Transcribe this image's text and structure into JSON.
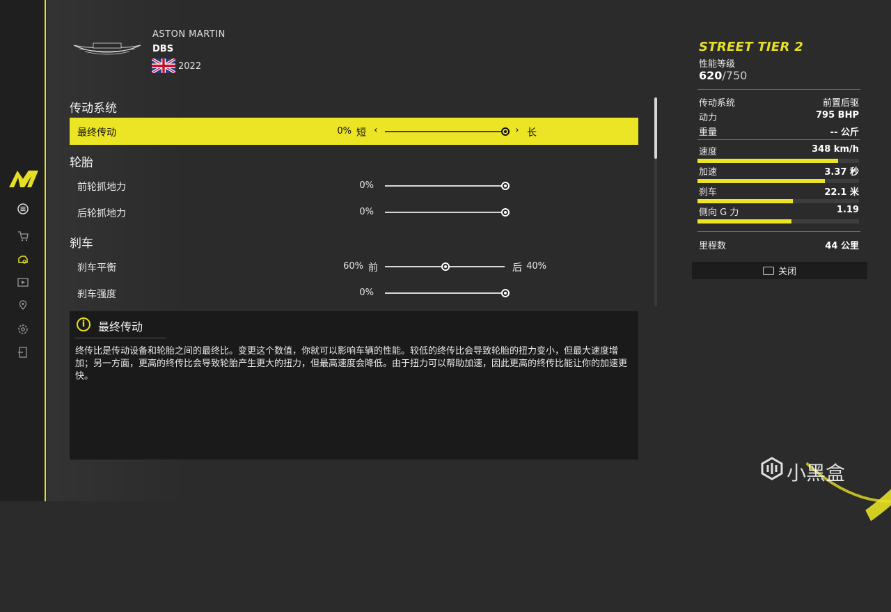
{
  "car": {
    "brand": "ASTON MARTIN",
    "model": "DBS",
    "year": "2022",
    "country_flag": "uk-flag-icon"
  },
  "sidebar": {
    "items": [
      {
        "icon": "menu-icon"
      },
      {
        "icon": "cart-icon"
      },
      {
        "icon": "car-tuning-icon"
      },
      {
        "icon": "video-icon"
      },
      {
        "icon": "map-pin-icon"
      },
      {
        "icon": "settings-icon"
      },
      {
        "icon": "exit-icon"
      }
    ]
  },
  "settings": {
    "sections": [
      {
        "title": "传动系统",
        "rows": [
          {
            "label": "最终传动",
            "value": "0%",
            "left_word": "短",
            "right_word": "长",
            "position": 1.0,
            "active": true
          }
        ]
      },
      {
        "title": "轮胎",
        "rows": [
          {
            "label": "前轮抓地力",
            "value": "0%",
            "position": 1.0
          },
          {
            "label": "后轮抓地力",
            "value": "0%",
            "position": 1.0
          }
        ]
      },
      {
        "title": "刹车",
        "rows": [
          {
            "label": "刹车平衡",
            "value": "60%",
            "left_word": "前",
            "right_word": "后",
            "right_value": "40%",
            "position": 0.5
          },
          {
            "label": "刹车强度",
            "value": "0%",
            "position": 1.0
          }
        ]
      }
    ]
  },
  "info": {
    "title": "最终传动",
    "text": "终传比是传动设备和轮胎之间的最终比。变更这个数值，你就可以影响车辆的性能。较低的终传比会导致轮胎的扭力变小，但最大速度增加；另一方面，更高的终传比会导致轮胎产生更大的扭力，但最高速度会降低。由于扭力可以帮助加速，因此更高的终传比能让你的加速更快。"
  },
  "stats": {
    "tier": "STREET TIER 2",
    "perf_label": "性能等级",
    "perf_value": "620",
    "perf_max": "/750",
    "drivetrain_label": "传动系统",
    "drivetrain_value": "前置后驱",
    "power_label": "动力",
    "power_value": "795 BHP",
    "weight_label": "重量",
    "weight_value": "-- 公斤",
    "bars": [
      {
        "label": "速度",
        "value": "348 km/h",
        "fill": 0.87
      },
      {
        "label": "加速",
        "value": "3.37 秒",
        "fill": 0.79
      },
      {
        "label": "刹车",
        "value": "22.1 米",
        "fill": 0.59
      },
      {
        "label": "侧向 G 力",
        "value": "1.19",
        "fill": 0.58
      }
    ],
    "mileage_label": "里程数",
    "mileage_value": "44 公里",
    "close_label": "关闭"
  },
  "watermark": "小黑盒",
  "colors": {
    "accent": "#ebe525",
    "background": "#2b2b2b",
    "panel": "#1a1a1a"
  }
}
